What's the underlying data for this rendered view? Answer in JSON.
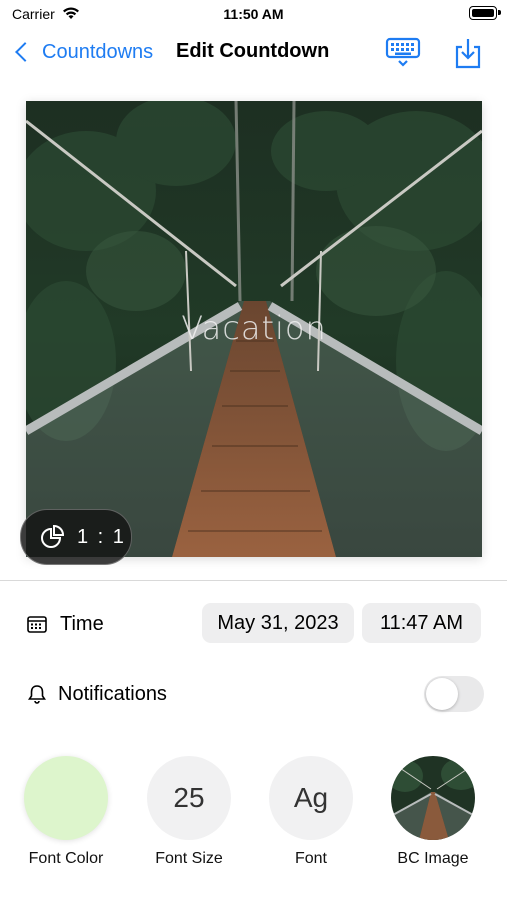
{
  "status_bar": {
    "carrier": "Carrier",
    "time": "11:50 AM"
  },
  "nav": {
    "back_label": "Countdowns",
    "title": "Edit Countdown",
    "icons": [
      "keyboard-icon",
      "share-download-icon"
    ]
  },
  "preview": {
    "label": "Vacation",
    "aspect_ratio": "1 : 1"
  },
  "time_row": {
    "label": "Time",
    "date": "May 31, 2023",
    "time": "11:47 AM"
  },
  "notifications": {
    "label": "Notifications",
    "enabled": false
  },
  "tools": [
    {
      "label": "Font Color",
      "value": "",
      "color": "#ddf5cc"
    },
    {
      "label": "Font Size",
      "value": "25"
    },
    {
      "label": "Font",
      "value": "Ag"
    },
    {
      "label": "BC Image",
      "value": ""
    }
  ],
  "colors": {
    "accent": "#1e7cf2",
    "pill_bg": "#eeeeef"
  }
}
